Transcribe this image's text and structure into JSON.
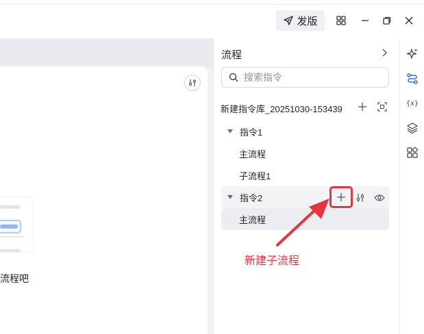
{
  "header": {
    "publish_label": "发版",
    "icons": [
      "send-icon",
      "grid-icon",
      "minimize-icon",
      "restore-icon",
      "close-icon"
    ]
  },
  "canvas": {
    "empty_text": "流程吧"
  },
  "panel": {
    "title": "流程",
    "search_placeholder": "搜索指令",
    "library_name": "新建指令库_20251030-153439",
    "tree": [
      {
        "label": "指令1",
        "expanded": true,
        "children": [
          {
            "label": "主流程"
          },
          {
            "label": "子流程1"
          }
        ]
      },
      {
        "label": "指令2",
        "expanded": true,
        "children": [
          {
            "label": "主流程",
            "selected": true
          }
        ]
      }
    ]
  },
  "annotation": {
    "text": "新建子流程",
    "color": "#e6363c"
  },
  "toolbar": {
    "var_label": "{x}",
    "icons": [
      "sparkle-icon",
      "flow-icon",
      "variable-icon",
      "layers-icon",
      "components-icon"
    ],
    "active": "flow-icon",
    "accent": "#2f6fed"
  }
}
